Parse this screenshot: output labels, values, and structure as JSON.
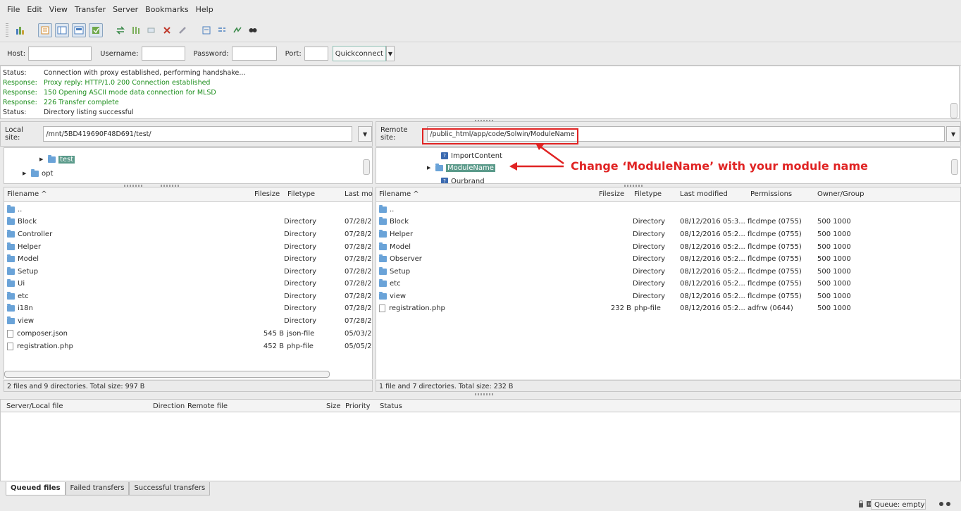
{
  "menu": [
    "File",
    "Edit",
    "View",
    "Transfer",
    "Server",
    "Bookmarks",
    "Help"
  ],
  "toolbar": {
    "icons": [
      "site-manager-icon",
      "toggle-log-icon",
      "toggle-local-tree-icon",
      "toggle-remote-tree-icon",
      "toggle-queue-icon",
      "refresh-icon",
      "process-queue-icon",
      "cancel-icon",
      "disconnect-icon",
      "reconnect-icon",
      "filter-icon",
      "compare-icon",
      "sync-browse-icon",
      "search-icon"
    ]
  },
  "quickconnect": {
    "host_label": "Host:",
    "username_label": "Username:",
    "password_label": "Password:",
    "port_label": "Port:",
    "button_label": "Quickconnect"
  },
  "log": [
    {
      "label": "Status:",
      "text": "Connection with proxy established, performing handshake...",
      "color": "#2a2a2a"
    },
    {
      "label": "Response:",
      "text": "Proxy reply: HTTP/1.0 200 Connection established",
      "color": "#1a8d1a"
    },
    {
      "label": "Response:",
      "text": "150 Opening ASCII mode data connection for MLSD",
      "color": "#1a8d1a"
    },
    {
      "label": "Response:",
      "text": "226 Transfer complete",
      "color": "#1a8d1a"
    },
    {
      "label": "Status:",
      "text": "Directory listing successful",
      "color": "#2a2a2a"
    }
  ],
  "local": {
    "site_label": "Local site:",
    "path": "/mnt/5BD419690F48D691/test/",
    "tree": [
      {
        "name": "test",
        "selected": true
      },
      {
        "name": "opt",
        "selected": false
      }
    ],
    "columns": {
      "filename": "Filename ^",
      "filesize": "Filesize",
      "filetype": "Filetype",
      "modified": "Last mo"
    },
    "files": [
      {
        "name": "..",
        "size": "",
        "type": "",
        "modified": "",
        "kind": "folder"
      },
      {
        "name": "Block",
        "size": "",
        "type": "Directory",
        "modified": "07/28/2",
        "kind": "folder"
      },
      {
        "name": "Controller",
        "size": "",
        "type": "Directory",
        "modified": "07/28/2",
        "kind": "folder"
      },
      {
        "name": "Helper",
        "size": "",
        "type": "Directory",
        "modified": "07/28/2",
        "kind": "folder"
      },
      {
        "name": "Model",
        "size": "",
        "type": "Directory",
        "modified": "07/28/2",
        "kind": "folder"
      },
      {
        "name": "Setup",
        "size": "",
        "type": "Directory",
        "modified": "07/28/2",
        "kind": "folder"
      },
      {
        "name": "Ui",
        "size": "",
        "type": "Directory",
        "modified": "07/28/2",
        "kind": "folder"
      },
      {
        "name": "etc",
        "size": "",
        "type": "Directory",
        "modified": "07/28/2",
        "kind": "folder"
      },
      {
        "name": "i18n",
        "size": "",
        "type": "Directory",
        "modified": "07/28/2",
        "kind": "folder"
      },
      {
        "name": "view",
        "size": "",
        "type": "Directory",
        "modified": "07/28/2",
        "kind": "folder"
      },
      {
        "name": "composer.json",
        "size": "545 B",
        "type": "json-file",
        "modified": "05/03/2",
        "kind": "file"
      },
      {
        "name": "registration.php",
        "size": "452 B",
        "type": "php-file",
        "modified": "05/05/2",
        "kind": "file"
      }
    ],
    "status": "2 files and 9 directories. Total size: 997 B"
  },
  "remote": {
    "site_label": "Remote site:",
    "path": "/public_html/app/code/Solwin/ModuleName",
    "tree": [
      {
        "name": "ImportContent",
        "selected": false
      },
      {
        "name": "ModuleName",
        "selected": true
      },
      {
        "name": "Ourbrand",
        "selected": false
      }
    ],
    "columns": {
      "filename": "Filename ^",
      "filesize": "Filesize",
      "filetype": "Filetype",
      "modified": "Last modified",
      "permissions": "Permissions",
      "owner": "Owner/Group"
    },
    "files": [
      {
        "name": "..",
        "size": "",
        "type": "",
        "modified": "",
        "perms": "",
        "owner": "",
        "kind": "folder"
      },
      {
        "name": "Block",
        "size": "",
        "type": "Directory",
        "modified": "08/12/2016 05:3...",
        "perms": "flcdmpe (0755)",
        "owner": "500 1000",
        "kind": "folder"
      },
      {
        "name": "Helper",
        "size": "",
        "type": "Directory",
        "modified": "08/12/2016 05:2...",
        "perms": "flcdmpe (0755)",
        "owner": "500 1000",
        "kind": "folder"
      },
      {
        "name": "Model",
        "size": "",
        "type": "Directory",
        "modified": "08/12/2016 05:2...",
        "perms": "flcdmpe (0755)",
        "owner": "500 1000",
        "kind": "folder"
      },
      {
        "name": "Observer",
        "size": "",
        "type": "Directory",
        "modified": "08/12/2016 05:2...",
        "perms": "flcdmpe (0755)",
        "owner": "500 1000",
        "kind": "folder"
      },
      {
        "name": "Setup",
        "size": "",
        "type": "Directory",
        "modified": "08/12/2016 05:2...",
        "perms": "flcdmpe (0755)",
        "owner": "500 1000",
        "kind": "folder"
      },
      {
        "name": "etc",
        "size": "",
        "type": "Directory",
        "modified": "08/12/2016 05:2...",
        "perms": "flcdmpe (0755)",
        "owner": "500 1000",
        "kind": "folder"
      },
      {
        "name": "view",
        "size": "",
        "type": "Directory",
        "modified": "08/12/2016 05:2...",
        "perms": "flcdmpe (0755)",
        "owner": "500 1000",
        "kind": "folder"
      },
      {
        "name": "registration.php",
        "size": "232 B",
        "type": "php-file",
        "modified": "08/12/2016 05:2...",
        "perms": "adfrw (0644)",
        "owner": "500 1000",
        "kind": "file"
      }
    ],
    "status": "1 file and 7 directories. Total size: 232 B"
  },
  "annotation": {
    "text": "Change ‘ModuleName’ with your module name",
    "color": "#e02323"
  },
  "queue": {
    "columns": [
      "Server/Local file",
      "Direction",
      "Remote file",
      "Size",
      "Priority",
      "Status"
    ],
    "tabs": [
      "Queued files",
      "Failed transfers",
      "Successful transfers"
    ],
    "status": "Queue: empty"
  }
}
